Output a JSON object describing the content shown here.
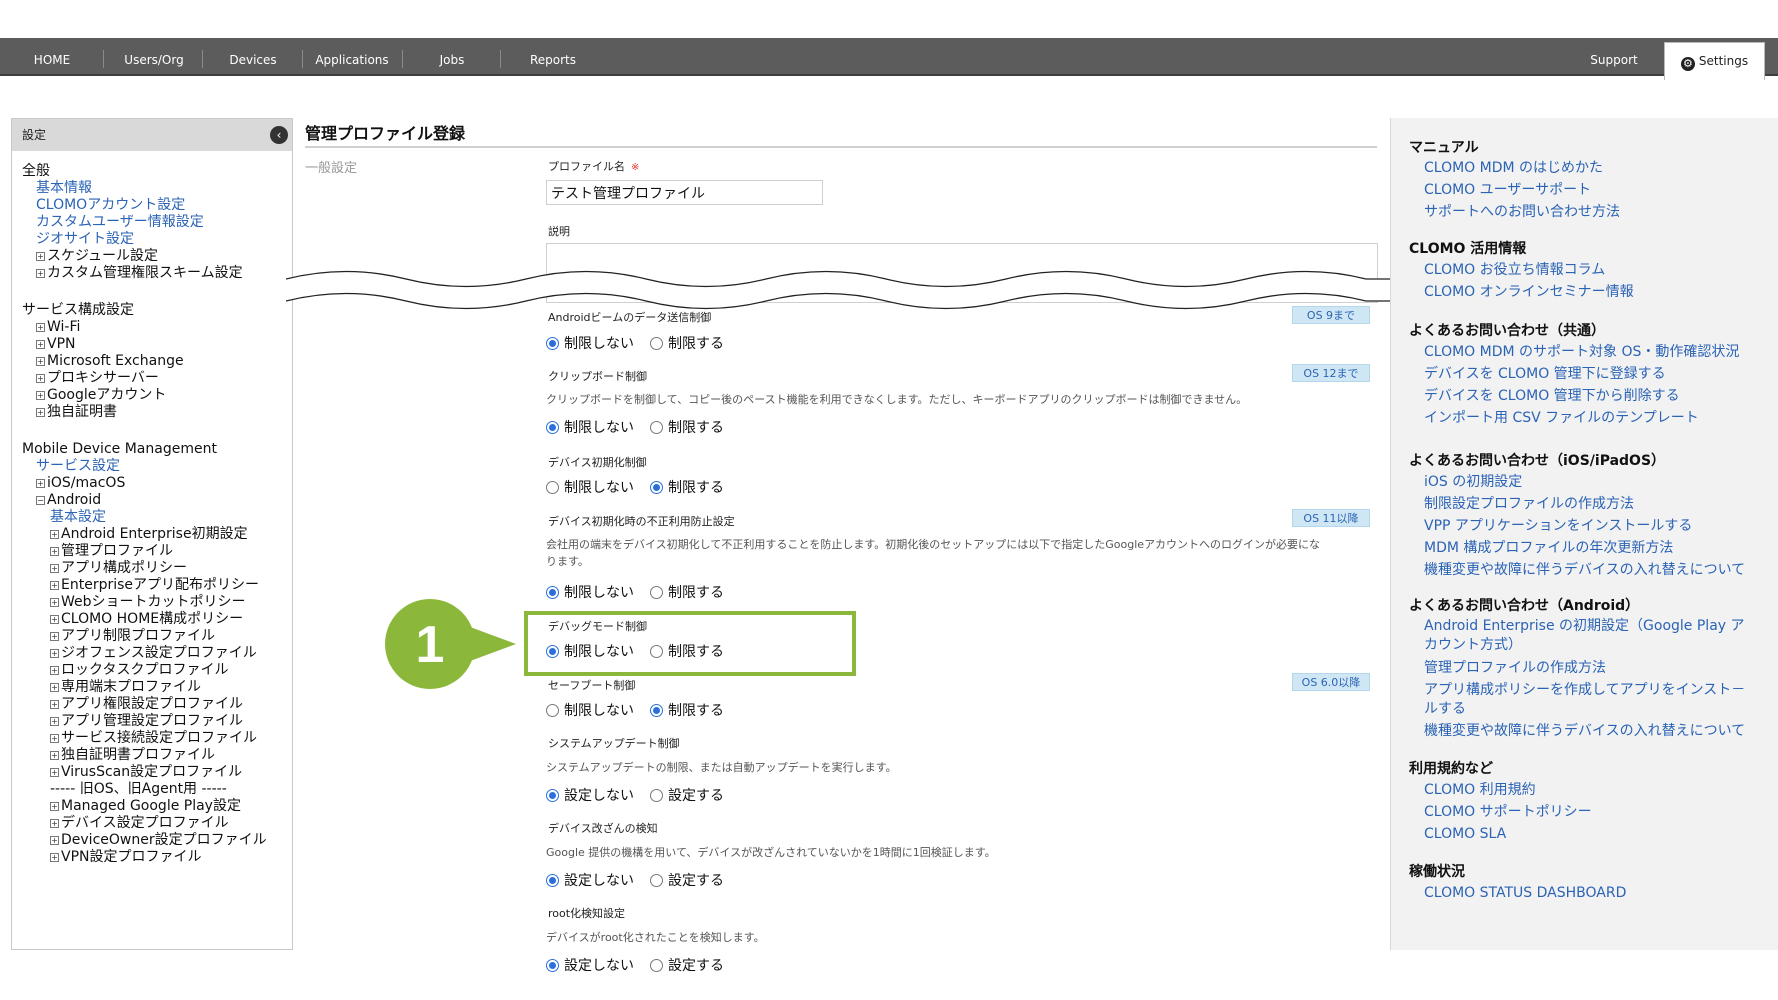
{
  "nav": {
    "items": [
      "HOME",
      "Users/Org",
      "Devices",
      "Applications",
      "Jobs",
      "Reports"
    ],
    "support": "Support",
    "settings": "Settings"
  },
  "sidebar": {
    "header": "設定",
    "sections": [
      {
        "text": "全般",
        "kind": "h"
      },
      {
        "text": "基本情報",
        "kind": "l"
      },
      {
        "text": "CLOMOアカウント設定",
        "kind": "l"
      },
      {
        "text": "カスタムユーザー情報設定",
        "kind": "l"
      },
      {
        "text": "ジオサイト設定",
        "kind": "l"
      },
      {
        "text": "スケジュール設定",
        "kind": "t",
        "toggle": "+"
      },
      {
        "text": "カスタム管理権限スキーム設定",
        "kind": "t",
        "toggle": "+"
      },
      {
        "text": "サービス構成設定",
        "kind": "h"
      },
      {
        "text": "Wi-Fi",
        "kind": "t",
        "toggle": "+"
      },
      {
        "text": "VPN",
        "kind": "t",
        "toggle": "+"
      },
      {
        "text": "Microsoft Exchange",
        "kind": "t",
        "toggle": "+"
      },
      {
        "text": "プロキシサーバー",
        "kind": "t",
        "toggle": "+"
      },
      {
        "text": "Googleアカウント",
        "kind": "t",
        "toggle": "+"
      },
      {
        "text": "独自証明書",
        "kind": "t",
        "toggle": "+"
      },
      {
        "text": "Mobile Device Management",
        "kind": "h"
      },
      {
        "text": "サービス設定",
        "kind": "l"
      },
      {
        "text": "iOS/macOS",
        "kind": "t",
        "toggle": "+"
      },
      {
        "text": "Android",
        "kind": "t",
        "toggle": "−"
      },
      {
        "text": "基本設定",
        "kind": "l"
      },
      {
        "text": "Android Enterprise初期設定",
        "kind": "t",
        "toggle": "+"
      },
      {
        "text": "管理プロファイル",
        "kind": "t",
        "toggle": "+"
      },
      {
        "text": "アプリ構成ポリシー",
        "kind": "t",
        "toggle": "+"
      },
      {
        "text": "Enterpriseアプリ配布ポリシー",
        "kind": "t",
        "toggle": "+"
      },
      {
        "text": "Webショートカットポリシー",
        "kind": "t",
        "toggle": "+"
      },
      {
        "text": "CLOMO HOME構成ポリシー",
        "kind": "t",
        "toggle": "+"
      },
      {
        "text": "アプリ制限プロファイル",
        "kind": "t",
        "toggle": "+"
      },
      {
        "text": "ジオフェンス設定プロファイル",
        "kind": "t",
        "toggle": "+"
      },
      {
        "text": "ロックタスクプロファイル",
        "kind": "t",
        "toggle": "+"
      },
      {
        "text": "専用端末プロファイル",
        "kind": "t",
        "toggle": "+"
      },
      {
        "text": "アプリ権限設定プロファイル",
        "kind": "t",
        "toggle": "+"
      },
      {
        "text": "アプリ管理設定プロファイル",
        "kind": "t",
        "toggle": "+"
      },
      {
        "text": "サービス接続設定プロファイル",
        "kind": "t",
        "toggle": "+"
      },
      {
        "text": "独自証明書プロファイル",
        "kind": "t",
        "toggle": "+"
      },
      {
        "text": "VirusScan設定プロファイル",
        "kind": "t",
        "toggle": "+"
      },
      {
        "text": "----- 旧OS、旧Agent用 -----",
        "kind": "h"
      },
      {
        "text": "Managed Google Play設定",
        "kind": "t",
        "toggle": "+"
      },
      {
        "text": "デバイス設定プロファイル",
        "kind": "t",
        "toggle": "+"
      },
      {
        "text": "DeviceOwner設定プロファイル",
        "kind": "t",
        "toggle": "+"
      },
      {
        "text": "VPN設定プロファイル",
        "kind": "t",
        "toggle": "+"
      }
    ]
  },
  "main": {
    "title": "管理プロファイル登録",
    "general_label": "一般設定",
    "profile_name_label": "プロファイル名",
    "required_mark": "※",
    "profile_name_value": "テスト管理プロファイル",
    "description_label": "説明",
    "settings": [
      {
        "label": "Androidビームのデータ送信制御",
        "badge": "OS 9まで",
        "desc": "",
        "opt1": "制限しない",
        "opt2": "制限する",
        "selected": 1
      },
      {
        "label": "クリップボード制御",
        "badge": "OS 12まで",
        "desc": "クリップボードを制御して、コピー後のペースト機能を利用できなくします。ただし、キーボードアプリのクリップボードは制御できません。",
        "opt1": "制限しない",
        "opt2": "制限する",
        "selected": 1
      },
      {
        "label": "デバイス初期化制御",
        "badge": "",
        "desc": "",
        "opt1": "制限しない",
        "opt2": "制限する",
        "selected": 2
      },
      {
        "label": "デバイス初期化時の不正利用防止設定",
        "badge": "OS 11以降",
        "desc": "会社用の端末をデバイス初期化して不正利用することを防止します。初期化後のセットアップには以下で指定したGoogleアカウントへのログインが必要にな",
        "desc2": "ります。",
        "opt1": "制限しない",
        "opt2": "制限する",
        "selected": 1
      },
      {
        "label": "デバッグモード制御",
        "badge": "",
        "desc": "",
        "opt1": "制限しない",
        "opt2": "制限する",
        "selected": 1
      },
      {
        "label": "セーフブート制御",
        "badge": "OS 6.0以降",
        "desc": "",
        "opt1": "制限しない",
        "opt2": "制限する",
        "selected": 2
      },
      {
        "label": "システムアップデート制御",
        "badge": "",
        "desc": "システムアップデートの制限、または自動アップデートを実行します。",
        "opt1": "設定しない",
        "opt2": "設定する",
        "selected": 1
      },
      {
        "label": "デバイス改ざんの検知",
        "badge": "",
        "desc": "Google 提供の機構を用いて、デバイスが改ざんされていないかを1時間に1回検証します。",
        "opt1": "設定しない",
        "opt2": "設定する",
        "selected": 1
      },
      {
        "label": "root化検知設定",
        "badge": "",
        "desc": "デバイスがroot化されたことを検知します。",
        "opt1": "設定しない",
        "opt2": "設定する",
        "selected": 1
      }
    ],
    "callout_number": "1",
    "highlight_color": "#8bb83a"
  },
  "right": {
    "groups": [
      {
        "heading": "マニュアル",
        "links": [
          "CLOMO MDM のはじめかた",
          "CLOMO ユーザーサポート",
          "サポートへのお問い合わせ方法"
        ]
      },
      {
        "heading": "CLOMO 活用情報",
        "links": [
          "CLOMO お役立ち情報コラム",
          "CLOMO オンラインセミナー情報"
        ]
      },
      {
        "heading": "よくあるお問い合わせ（共通）",
        "links": [
          "CLOMO MDM のサポート対象 OS・動作確認状況",
          "デバイスを CLOMO 管理下に登録する",
          "デバイスを CLOMO 管理下から削除する",
          "インポート用 CSV ファイルのテンプレート"
        ]
      },
      {
        "heading": "よくあるお問い合わせ（iOS/iPadOS）",
        "links": [
          "iOS の初期設定",
          "制限設定プロファイルの作成方法",
          "VPP アプリケーションをインストールする",
          "MDM 構成プロファイルの年次更新方法",
          "機種変更や故障に伴うデバイスの入れ替えについて"
        ]
      },
      {
        "heading": "よくあるお問い合わせ（Android）",
        "links": [
          "Android Enterprise の初期設定（Google Play ア",
          "カウント方式）",
          "管理プロファイルの作成方法",
          "アプリ構成ポリシーを作成してアプリをインスト－",
          "ルする",
          "機種変更や故障に伴うデバイスの入れ替えについて"
        ]
      },
      {
        "heading": "利用規約など",
        "links": [
          "CLOMO 利用規約",
          "CLOMO サポートポリシー",
          "CLOMO SLA"
        ]
      },
      {
        "heading": "稼働状況",
        "links": [
          "CLOMO STATUS DASHBOARD"
        ]
      }
    ]
  }
}
